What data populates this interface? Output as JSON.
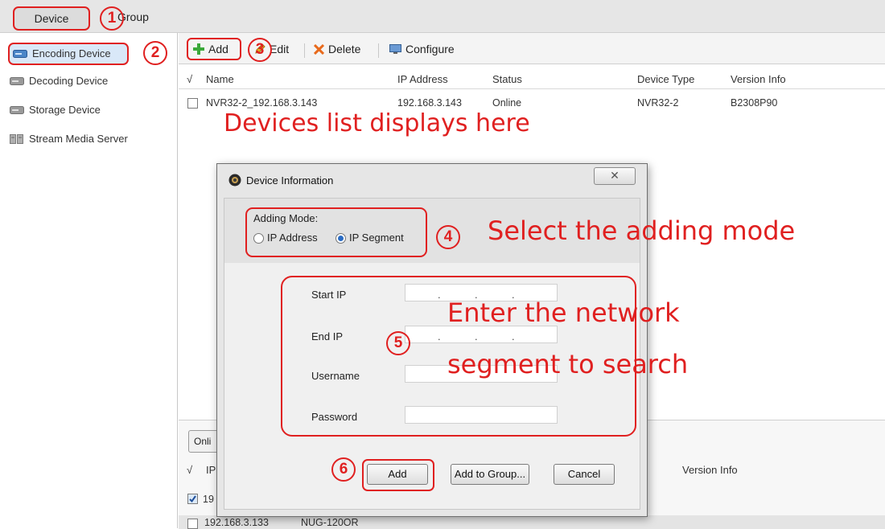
{
  "top_tabs": {
    "device": "Device",
    "group": "Group"
  },
  "sidebar": {
    "items": [
      {
        "label": "Encoding Device"
      },
      {
        "label": "Decoding Device"
      },
      {
        "label": "Storage Device"
      },
      {
        "label": "Stream Media Server"
      }
    ]
  },
  "toolbar": {
    "add": "Add",
    "edit": "Edit",
    "delete": "Delete",
    "configure": "Configure"
  },
  "device_table": {
    "columns": {
      "check": "√",
      "name": "Name",
      "ip": "IP Address",
      "status": "Status",
      "type": "Device Type",
      "version": "Version Info"
    },
    "rows": [
      {
        "name": "NVR32-2_192.168.3.143",
        "ip": "192.168.3.143",
        "status": "Online",
        "type": "NVR32-2",
        "version": "B2308P90"
      }
    ]
  },
  "annotations": {
    "devices_list": "Devices list displays here",
    "adding_mode": "Select the adding mode",
    "segment_line1": "Enter the network",
    "segment_line2": "segment to search",
    "steps": [
      "1",
      "2",
      "3",
      "4",
      "5",
      "6"
    ]
  },
  "dialog": {
    "title": "Device Information",
    "close_glyph": "✕",
    "adding_mode_label": "Adding Mode:",
    "mode_options": [
      "IP Address",
      "IP Segment"
    ],
    "selected_mode": "IP Segment",
    "fields": {
      "start_ip": "Start IP",
      "end_ip": "End IP",
      "username": "Username",
      "password": "Password"
    },
    "ip_separator": ".",
    "buttons": {
      "add": "Add",
      "add_to_group": "Add to Group...",
      "cancel": "Cancel"
    }
  },
  "lower_pane": {
    "online_button": "Onli",
    "columns": {
      "check": "√",
      "ip": "IP",
      "version": "Version Info"
    },
    "rows": [
      {
        "ip": "19",
        "checked": true
      },
      {
        "ip": "192.168.3.133",
        "type": "NUG-120OR",
        "checked": false
      }
    ]
  },
  "colors": {
    "annotation_red": "#e02020",
    "selection_blue": "#d9e8f8",
    "add_green": "#3aa83a",
    "delete_orange": "#e86a1c"
  }
}
